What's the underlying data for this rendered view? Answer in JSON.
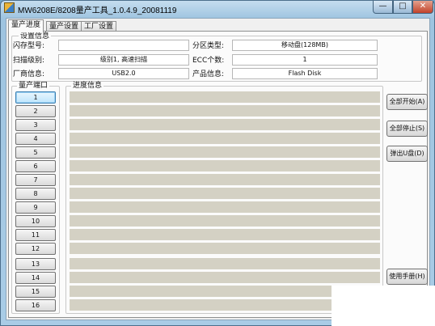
{
  "window": {
    "title": "MW6208E/8208量产工具_1.0.4.9_20081119",
    "min_glyph": "—",
    "max_glyph": "□",
    "close_glyph": "✕"
  },
  "tabs": [
    {
      "label": "量产进度",
      "active": true
    },
    {
      "label": "量产设置",
      "active": false
    },
    {
      "label": "工厂设置",
      "active": false
    }
  ],
  "settings": {
    "group_label": "设置信息",
    "flash_model_label": "闪存型号:",
    "flash_model_value": "",
    "partition_type_label": "分区类型:",
    "partition_type_value": "移动盘(128MB)",
    "scan_level_label": "扫描级别:",
    "scan_level_value": "级别1, 高速扫描",
    "ecc_count_label": "ECC个数:",
    "ecc_count_value": "1",
    "vendor_info_label": "厂商信息:",
    "vendor_info_value": "USB2.0",
    "product_info_label": "产品信息:",
    "product_info_value": "Flash Disk"
  },
  "ports": {
    "group_label": "量产端口",
    "labels": [
      "1",
      "2",
      "3",
      "4",
      "5",
      "6",
      "7",
      "8",
      "9",
      "10",
      "11",
      "12",
      "13",
      "14",
      "15",
      "16"
    ]
  },
  "progress": {
    "group_label": "进度信息",
    "values": [
      0,
      0,
      0,
      0,
      0,
      0,
      0,
      0,
      0,
      0,
      0,
      0,
      0,
      0,
      0,
      0
    ]
  },
  "actions": {
    "start_all": "全部开始(A)",
    "stop_all": "全部停止(S)",
    "eject_udisk": "弹出U盘(D)",
    "user_manual": "使用手册(H)"
  },
  "colors": {
    "progress_track": "#d4d1c4",
    "title_gradient": "#a9cce6",
    "close_button": "#c2432a"
  }
}
